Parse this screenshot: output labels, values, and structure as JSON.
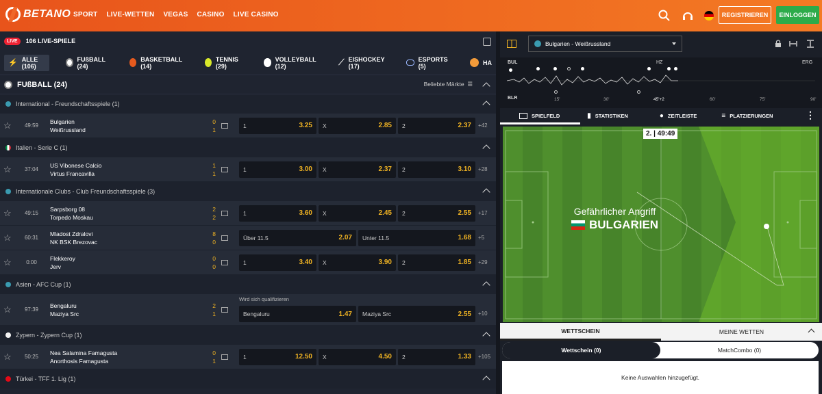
{
  "brand": "BETANO",
  "nav": [
    "SPORT",
    "LIVE-WETTEN",
    "VEGAS",
    "CASINO",
    "LIVE CASINO"
  ],
  "header": {
    "register": "REGISTRIEREN",
    "login": "EINLOGGEN"
  },
  "live": {
    "badge": "LIVE",
    "count_label": "106 LIVE-SPIELE"
  },
  "sports": [
    {
      "label": "ALLE (106)",
      "icon": "lightning-icon"
    },
    {
      "label": "FUßBALL (24)",
      "icon": "football-icon"
    },
    {
      "label": "BASKETBALL (14)",
      "icon": "basketball-icon"
    },
    {
      "label": "TENNIS (29)",
      "icon": "tennis-icon"
    },
    {
      "label": "VOLLEYBALL (12)",
      "icon": "volleyball-icon"
    },
    {
      "label": "EISHOCKEY (17)",
      "icon": "hockey-icon"
    },
    {
      "label": "ESPORTS (5)",
      "icon": "gamepad-icon"
    },
    {
      "label": "HA",
      "icon": "handball-icon"
    }
  ],
  "section": {
    "title": "FUßBALL (24)",
    "markets": "Beliebte Märkte"
  },
  "leagues": [
    {
      "name": "International - Freundschaftsspiele (1)"
    },
    {
      "name": "Italien - Serie C (1)"
    },
    {
      "name": "Internationale Clubs - Club Freundschaftsspiele (3)"
    },
    {
      "name": "Asien - AFC Cup (1)"
    },
    {
      "name": "Zypern - Zypern Cup (1)"
    },
    {
      "name": "Türkei - TFF 1. Lig (1)"
    }
  ],
  "matches": [
    {
      "time": "49:59",
      "home": "Bulgarien",
      "away": "Weißrussland",
      "s1": "0",
      "s2": "1",
      "o1l": "1",
      "o1v": "3.25",
      "o2l": "X",
      "o2v": "2.85",
      "o3l": "2",
      "o3v": "2.37",
      "more": "+42"
    },
    {
      "time": "37:04",
      "home": "US Vibonese Calcio",
      "away": "Virtus Francavilla",
      "s1": "1",
      "s2": "1",
      "o1l": "1",
      "o1v": "3.00",
      "o2l": "X",
      "o2v": "2.37",
      "o3l": "2",
      "o3v": "3.10",
      "more": "+28"
    },
    {
      "time": "49:15",
      "home": "Sarpsborg 08",
      "away": "Torpedo Moskau",
      "s1": "2",
      "s2": "2",
      "o1l": "1",
      "o1v": "3.60",
      "o2l": "X",
      "o2v": "2.45",
      "o3l": "2",
      "o3v": "2.55",
      "more": "+17"
    },
    {
      "time": "60:31",
      "home": "Mladost Zdralovi",
      "away": "NK BSK Brezovac",
      "s1": "8",
      "s2": "0",
      "o1l": "Über 11.5",
      "o1v": "2.07",
      "o3l": "Unter 11.5",
      "o3v": "1.68",
      "more": "+5"
    },
    {
      "time": "0:00",
      "home": "Flekkeroy",
      "away": "Jerv",
      "s1": "0",
      "s2": "0",
      "o1l": "1",
      "o1v": "3.40",
      "o2l": "X",
      "o2v": "3.90",
      "o3l": "2",
      "o3v": "1.85",
      "more": "+29"
    },
    {
      "time": "97:39",
      "home": "Bengaluru",
      "away": "Maziya Src",
      "s1": "2",
      "s2": "1",
      "qualify": "Wird sich qualifizieren",
      "o1l": "Bengaluru",
      "o1v": "1.47",
      "o3l": "Maziya Src",
      "o3v": "2.55",
      "more": "+10"
    },
    {
      "time": "50:25",
      "home": "Nea Salamina Famagusta",
      "away": "Anorthosis Famagusta",
      "s1": "0",
      "s2": "1",
      "o1l": "1",
      "o1v": "12.50",
      "o2l": "X",
      "o2v": "4.50",
      "o3l": "2",
      "o3v": "1.33",
      "more": "+105"
    }
  ],
  "right": {
    "match_select": "Bulgarien - Weißrussland",
    "timeline": {
      "home": "BUL",
      "away": "BLR",
      "ht": "HZ",
      "ft": "ERG",
      "ticks": [
        "15'",
        "30'",
        "45'+2",
        "60'",
        "75'",
        "90'"
      ]
    },
    "tabs": [
      "SPIELFELD",
      "STATISTIKEN",
      "ZEITLEISTE",
      "PLATZIERUNGEN"
    ],
    "clock": "2. | 49:49",
    "event_title": "Gefährlicher Angriff",
    "event_team": "BULGARIEN"
  },
  "betslip": {
    "tab1": "WETTSCHEIN",
    "tab2": "MEINE WETTEN",
    "opt1": "Wettschein (0)",
    "opt2": "MatchCombo (0)",
    "empty": "Keine Auswahlen hinzugefügt."
  },
  "colors": {
    "brand_orange": "#f0682a",
    "odds_yellow": "#f0b323",
    "login_green": "#2dab4a"
  }
}
